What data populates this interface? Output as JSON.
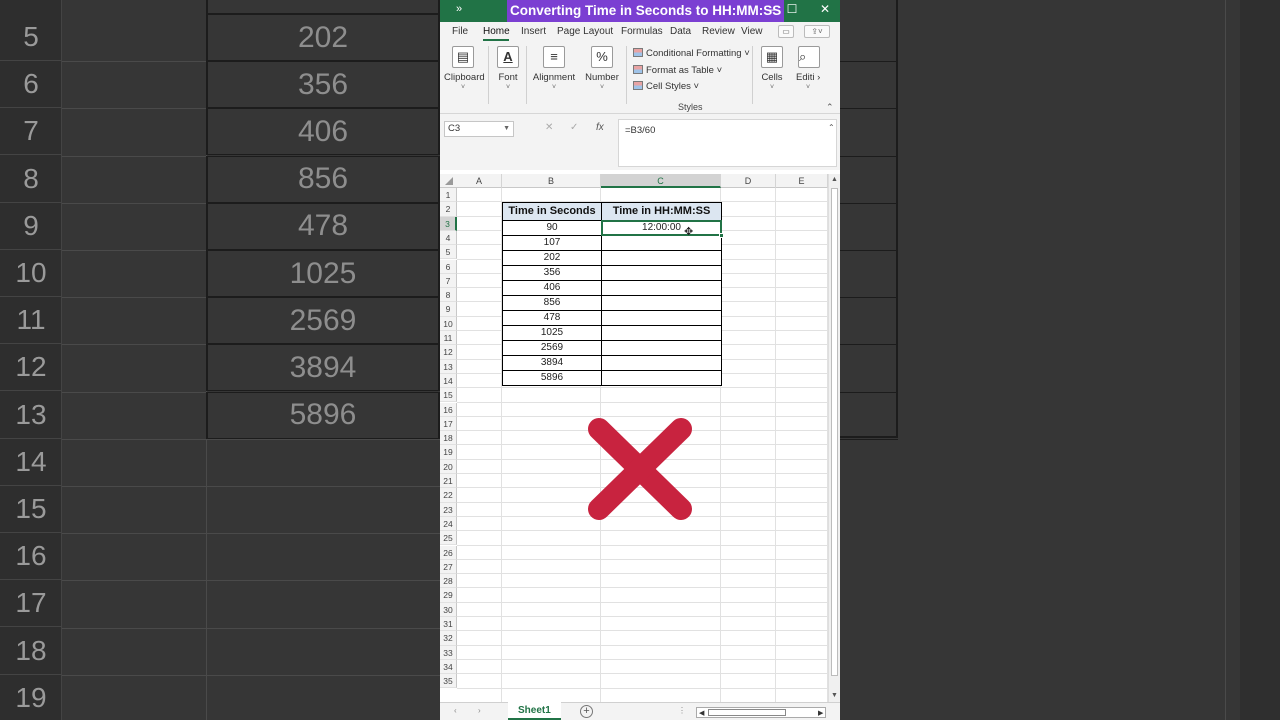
{
  "window": {
    "title": "Converting Time in Seconds to HH:MM:SS",
    "qat_label": "»",
    "minimize": "—",
    "restore": "☐",
    "close": "✕"
  },
  "tabs": [
    {
      "label": "File"
    },
    {
      "label": "Home"
    },
    {
      "label": "Insert"
    },
    {
      "label": "Page Layout"
    },
    {
      "label": "Formulas"
    },
    {
      "label": "Data"
    },
    {
      "label": "Review"
    },
    {
      "label": "View"
    }
  ],
  "ribbon": {
    "clipboard": "Clipboard",
    "font": "Font",
    "alignment": "Alignment",
    "number": "Number",
    "number_icon": "%",
    "conditional_formatting": "Conditional Formatting ˅",
    "format_as_table": "Format as Table ˅",
    "cell_styles": "Cell Styles ˅",
    "styles_group": "Styles",
    "cells": "Cells",
    "editing": "Editi"
  },
  "formula_bar": {
    "name_box": "C3",
    "formula": "=B3/60"
  },
  "grid": {
    "columns": [
      "A",
      "B",
      "C",
      "D",
      "E"
    ],
    "rows": [
      "1",
      "2",
      "3",
      "4",
      "5",
      "6",
      "7",
      "8",
      "9",
      "10",
      "11",
      "12",
      "13",
      "14",
      "15",
      "16",
      "17",
      "18",
      "19",
      "20",
      "21",
      "22",
      "23",
      "24",
      "25",
      "26",
      "27",
      "28",
      "29",
      "30",
      "31",
      "32",
      "33",
      "34",
      "35"
    ],
    "headers": [
      "Time in Seconds",
      "Time in HH:MM:SS"
    ],
    "seconds": [
      "90",
      "107",
      "202",
      "356",
      "406",
      "856",
      "478",
      "1025",
      "2569",
      "3894",
      "5896"
    ],
    "converted": [
      "12:00:00",
      "",
      "",
      "",
      "",
      "",
      "",
      "",
      "",
      "",
      ""
    ]
  },
  "sheets": {
    "active": "Sheet1",
    "add": "+"
  },
  "background": {
    "rows": [
      {
        "num": "5",
        "value": "202"
      },
      {
        "num": "6",
        "value": "356"
      },
      {
        "num": "7",
        "value": "406"
      },
      {
        "num": "8",
        "value": "856"
      },
      {
        "num": "9",
        "value": "478"
      },
      {
        "num": "10",
        "value": "1025"
      },
      {
        "num": "11",
        "value": "2569"
      },
      {
        "num": "12",
        "value": "3894"
      },
      {
        "num": "13",
        "value": "5896"
      },
      {
        "num": "14",
        "value": ""
      },
      {
        "num": "15",
        "value": ""
      },
      {
        "num": "16",
        "value": ""
      },
      {
        "num": "17",
        "value": ""
      },
      {
        "num": "18",
        "value": ""
      },
      {
        "num": "19",
        "value": ""
      }
    ]
  },
  "colors": {
    "excel_green": "#217346",
    "title_highlight": "#7b3fd2",
    "header_fill": "#dce6f1",
    "cross_red": "#c8233f"
  },
  "icons": {
    "cross": "red-x-icon"
  }
}
